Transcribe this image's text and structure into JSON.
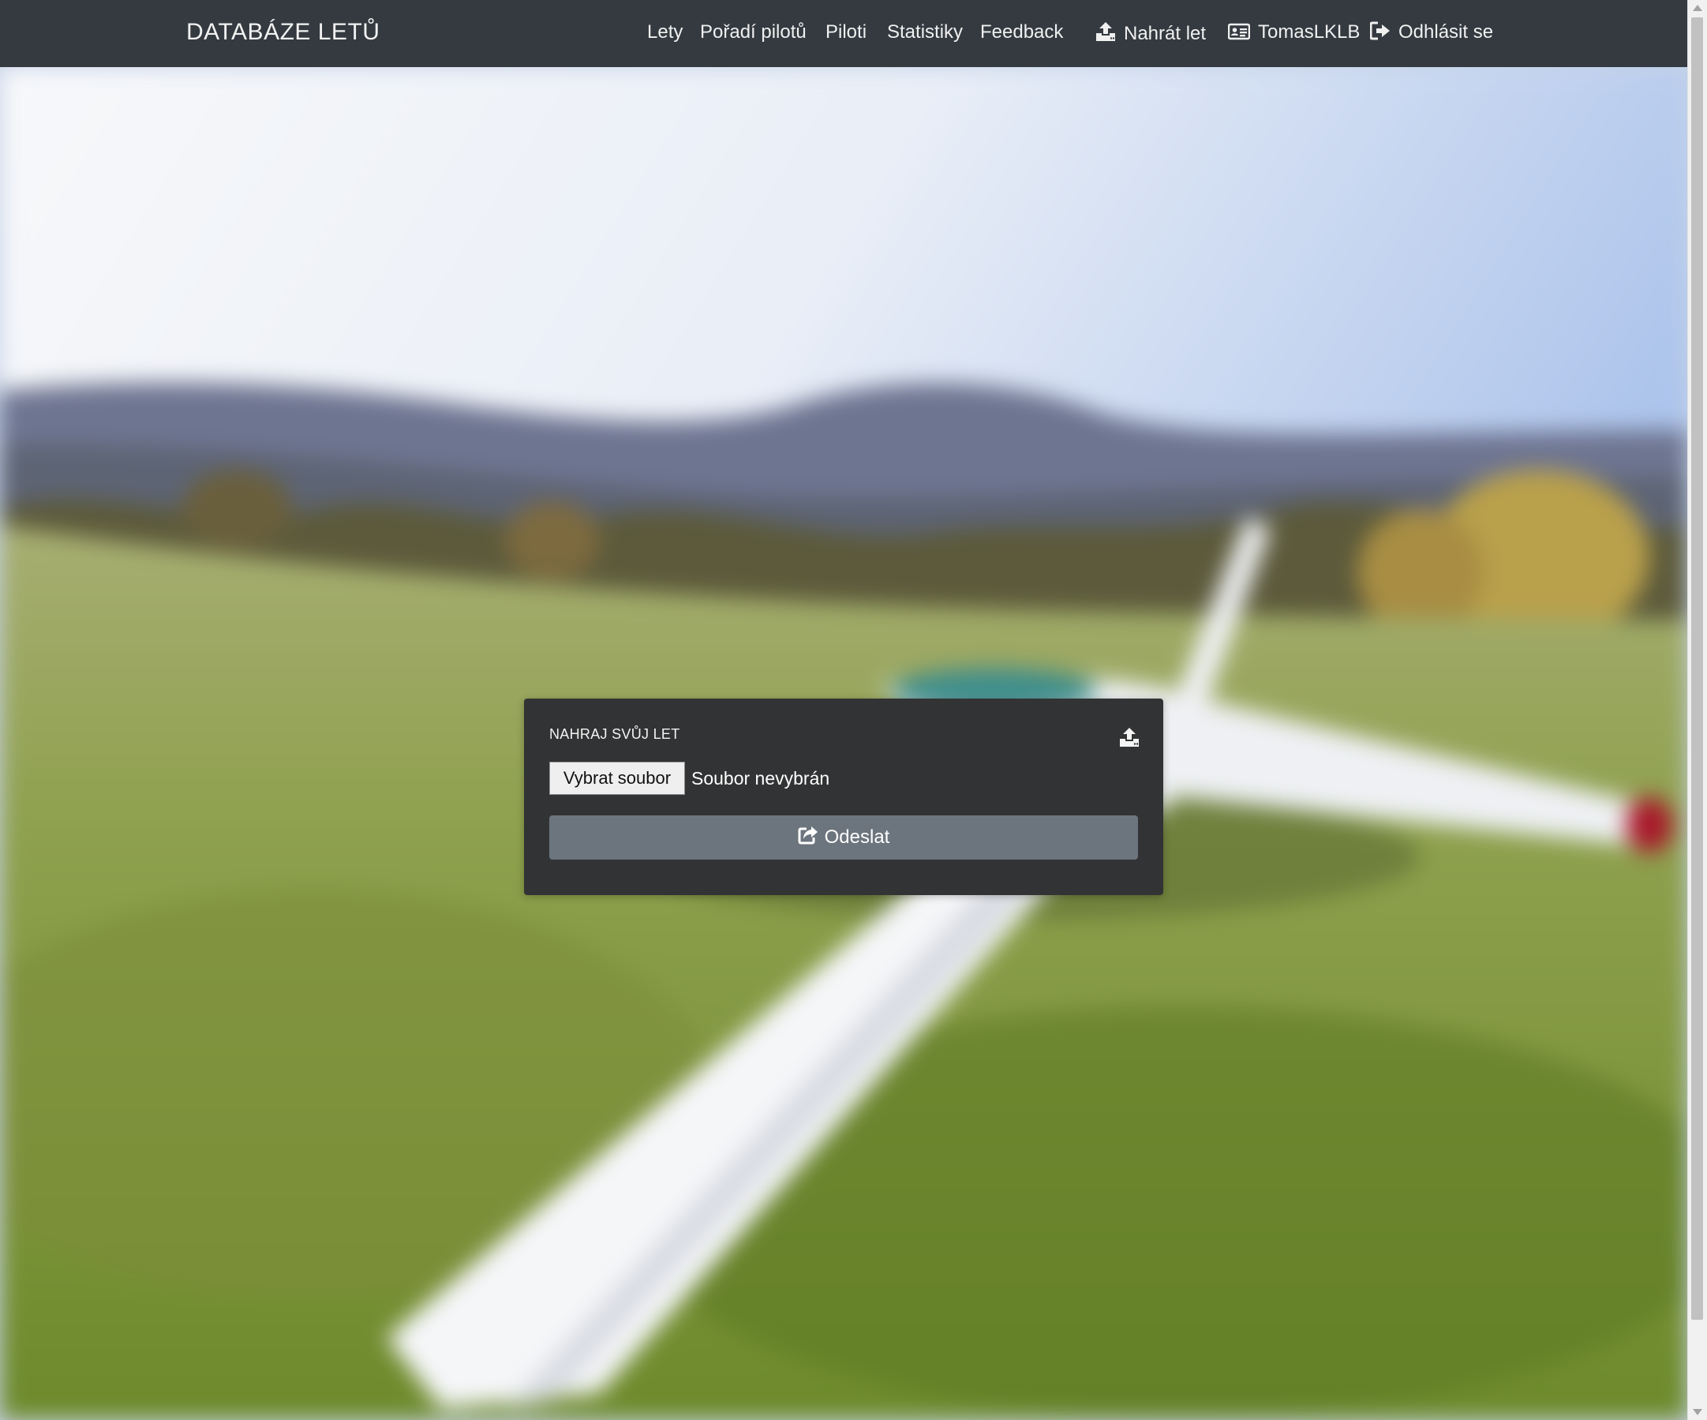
{
  "navbar": {
    "brand": "DATABÁZE LETŮ",
    "links": [
      {
        "label": "Lety"
      },
      {
        "label": "Pořadí pilotů"
      },
      {
        "label": "Piloti"
      },
      {
        "label": "Statistiky"
      },
      {
        "label": "Feedback"
      }
    ],
    "upload": {
      "label": "Nahrát let",
      "icon": "upload-icon"
    },
    "profile": {
      "label": "TomasLKLB",
      "icon": "id-card-icon"
    },
    "logout": {
      "label": "Odhlásit se",
      "icon": "sign-out-icon"
    }
  },
  "upload_card": {
    "title": "NAHRAJ SVŮJ LET",
    "header_icon": "upload-icon",
    "file_button_label": "Vybrat soubor",
    "file_status": "Soubor nevybrán",
    "submit_label": "Odeslat",
    "submit_icon": "share-icon"
  },
  "colors": {
    "navbar_bg": "#343a40",
    "card_bg": "#323334",
    "submit_bg": "#6c757d"
  }
}
